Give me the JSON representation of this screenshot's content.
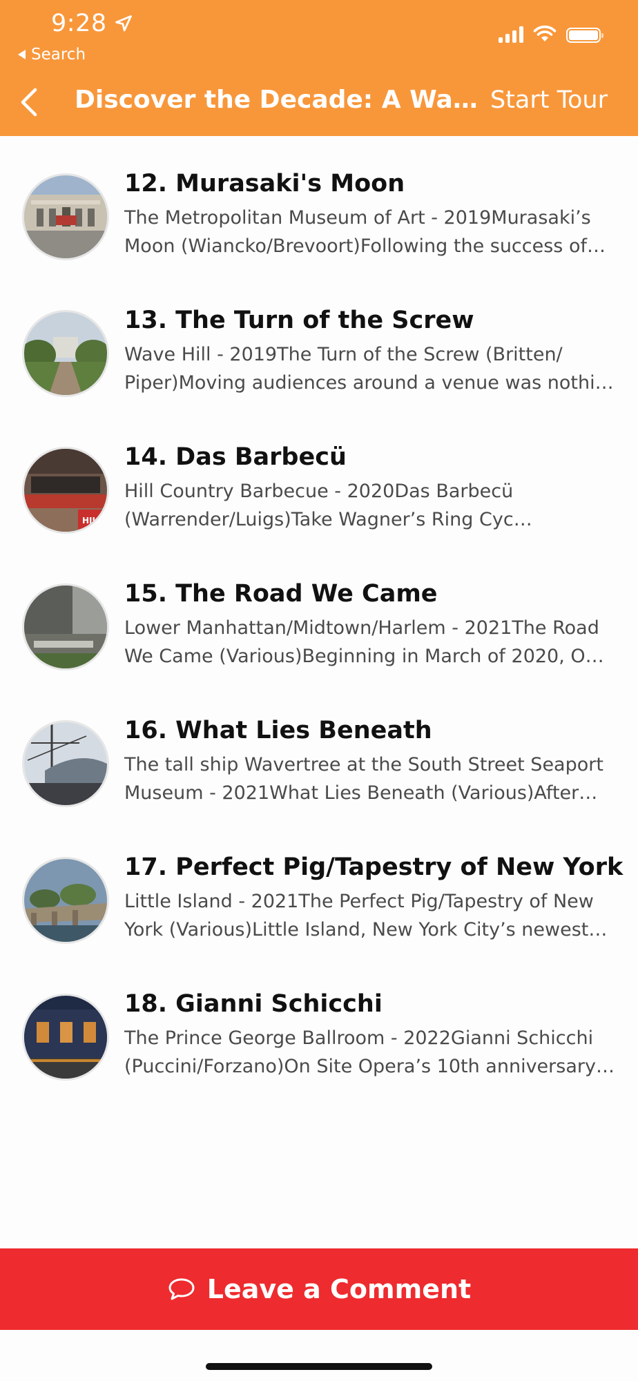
{
  "status_bar": {
    "time": "9:28",
    "back_app_label": "Search"
  },
  "nav": {
    "title": "Discover the Decade: A Walk...",
    "start_tour_label": "Start Tour"
  },
  "colors": {
    "header_bg": "#f8973a",
    "comment_bar_bg": "#ee2b2e"
  },
  "items": [
    {
      "title": "12. Murasaki's Moon",
      "description": "The Metropolitan Museum of Art - 2019Murasaki’s Moon (Wiancko/Brevoort)Following the success of…",
      "thumb_icon": "museum-photo"
    },
    {
      "title": "13. The Turn of the Screw",
      "description": "Wave Hill - 2019The Turn of the Screw (Britten/ Piper)Moving audiences around a venue was nothi…",
      "thumb_icon": "garden-photo"
    },
    {
      "title": "14. Das Barbecü",
      "description": "Hill Country Barbecue - 2020Das Barbecü (Warrender/Luigs)Take Wagner’s Ring Cyc…",
      "thumb_icon": "restaurant-photo"
    },
    {
      "title": "15. The Road We Came",
      "description": "Lower Manhattan/Midtown/Harlem - 2021The Road We Came (Various)Beginning in March of 2020, O…",
      "thumb_icon": "plaza-photo"
    },
    {
      "title": "16. What Lies Beneath",
      "description": "The tall ship Wavertree at the South Street Seaport Museum - 2021What Lies Beneath (Various)After o…",
      "thumb_icon": "tall-ship-photo"
    },
    {
      "title": "17. Perfect Pig/Tapestry of New York",
      "description": "Little Island - 2021The Perfect Pig/Tapestry of New York (Various)Little Island, New York City’s newest…",
      "thumb_icon": "island-park-photo"
    },
    {
      "title": "18. Gianni Schicchi",
      "description": "The Prince George Ballroom - 2022Gianni Schicchi (Puccini/Forzano)On Site Opera’s 10th anniversary…",
      "thumb_icon": "ballroom-photo"
    }
  ],
  "footer": {
    "comment_label": "Leave a Comment"
  }
}
